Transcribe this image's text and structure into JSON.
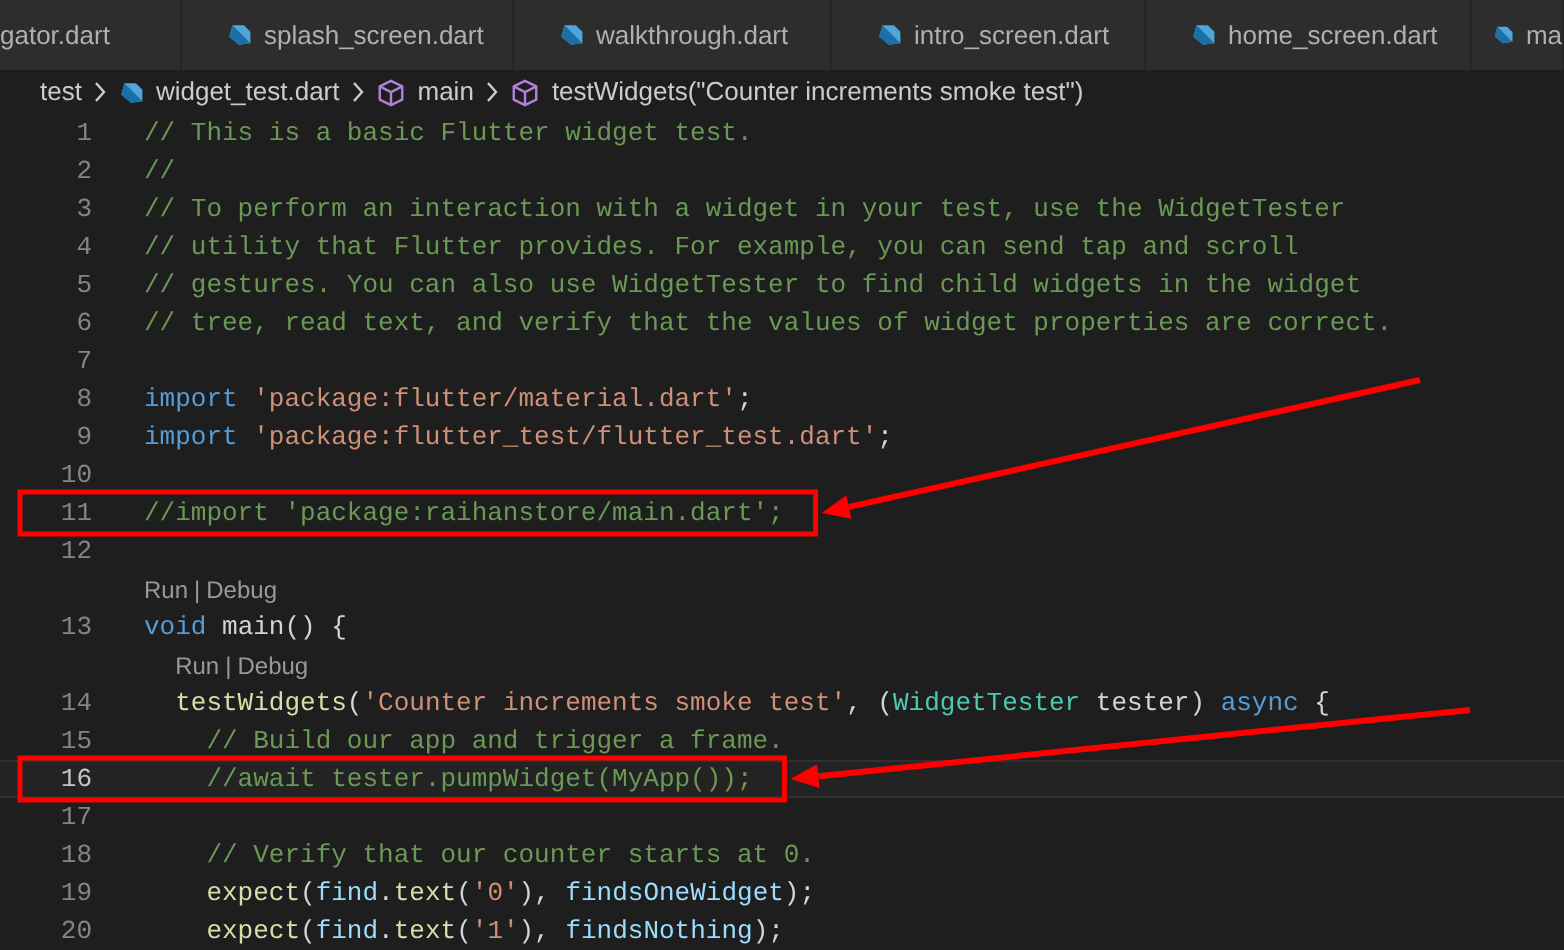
{
  "tabs": [
    {
      "label": "gator.dart",
      "icon": false,
      "selected": false
    },
    {
      "label": "splash_screen.dart",
      "icon": true,
      "selected": false
    },
    {
      "label": "walkthrough.dart",
      "icon": true,
      "selected": false
    },
    {
      "label": "intro_screen.dart",
      "icon": true,
      "selected": false
    },
    {
      "label": "home_screen.dart",
      "icon": true,
      "selected": false
    },
    {
      "label": "ma",
      "icon": true,
      "selected": false
    }
  ],
  "breadcrumb": [
    {
      "label": "test",
      "kind": "folder"
    },
    {
      "label": "widget_test.dart",
      "kind": "file"
    },
    {
      "label": "main",
      "kind": "symbol"
    },
    {
      "label": "testWidgets(\"Counter increments smoke test\")",
      "kind": "symbol"
    }
  ],
  "editor": {
    "rows": [
      {
        "kind": "code",
        "number": "1",
        "current": false,
        "annotated": false,
        "tokens": [
          {
            "kind": "comment",
            "text": "// This is a basic Flutter widget test."
          }
        ]
      },
      {
        "kind": "code",
        "number": "2",
        "current": false,
        "annotated": false,
        "tokens": [
          {
            "kind": "comment",
            "text": "//"
          }
        ]
      },
      {
        "kind": "code",
        "number": "3",
        "current": false,
        "annotated": false,
        "tokens": [
          {
            "kind": "comment",
            "text": "// To perform an interaction with a widget in your test, use the WidgetTester"
          }
        ]
      },
      {
        "kind": "code",
        "number": "4",
        "current": false,
        "annotated": false,
        "tokens": [
          {
            "kind": "comment",
            "text": "// utility that Flutter provides. For example, you can send tap and scroll"
          }
        ]
      },
      {
        "kind": "code",
        "number": "5",
        "current": false,
        "annotated": false,
        "tokens": [
          {
            "kind": "comment",
            "text": "// gestures. You can also use WidgetTester to find child widgets in the widget"
          }
        ]
      },
      {
        "kind": "code",
        "number": "6",
        "current": false,
        "annotated": false,
        "tokens": [
          {
            "kind": "comment",
            "text": "// tree, read text, and verify that the values of widget properties are correct."
          }
        ]
      },
      {
        "kind": "code",
        "number": "7",
        "current": false,
        "annotated": false,
        "tokens": []
      },
      {
        "kind": "code",
        "number": "8",
        "current": false,
        "annotated": false,
        "tokens": [
          {
            "kind": "keyword",
            "text": "import"
          },
          {
            "kind": "string",
            "text": " 'package:flutter/material.dart'"
          },
          {
            "kind": "plain",
            "text": ";"
          }
        ]
      },
      {
        "kind": "code",
        "number": "9",
        "current": false,
        "annotated": false,
        "tokens": [
          {
            "kind": "keyword",
            "text": "import"
          },
          {
            "kind": "string",
            "text": " 'package:flutter_test/flutter_test.dart'"
          },
          {
            "kind": "plain",
            "text": ";"
          }
        ]
      },
      {
        "kind": "code",
        "number": "10",
        "current": false,
        "annotated": false,
        "tokens": []
      },
      {
        "kind": "code",
        "number": "11",
        "current": false,
        "annotated": true,
        "tokens": [
          {
            "kind": "comment",
            "text": "//import 'package:raihanstore/main.dart';"
          }
        ]
      },
      {
        "kind": "code",
        "number": "12",
        "current": false,
        "annotated": false,
        "tokens": []
      },
      {
        "kind": "codelens",
        "links": [
          "Run",
          "Debug"
        ],
        "separator": "|"
      },
      {
        "kind": "code",
        "number": "13",
        "current": false,
        "annotated": false,
        "tokens": [
          {
            "kind": "keyword",
            "text": "void"
          },
          {
            "kind": "plain",
            "text": " main() {"
          }
        ]
      },
      {
        "kind": "codelens",
        "links": [
          "Run",
          "Debug"
        ],
        "separator": "|"
      },
      {
        "kind": "code",
        "number": "14",
        "current": false,
        "annotated": false,
        "tokens": [
          {
            "kind": "fn",
            "text": "  testWidgets"
          },
          {
            "kind": "plain",
            "text": "("
          },
          {
            "kind": "string",
            "text": "'Counter increments smoke test'"
          },
          {
            "kind": "plain",
            "text": ", ("
          },
          {
            "kind": "type",
            "text": "WidgetTester"
          },
          {
            "kind": "plain",
            "text": " tester) "
          },
          {
            "kind": "keyword",
            "text": "async"
          },
          {
            "kind": "plain",
            "text": " {"
          }
        ]
      },
      {
        "kind": "code",
        "number": "15",
        "current": false,
        "annotated": false,
        "tokens": [
          {
            "kind": "comment",
            "text": "    // Build our app and trigger a frame."
          }
        ]
      },
      {
        "kind": "code",
        "number": "16",
        "current": true,
        "annotated": true,
        "tokens": [
          {
            "kind": "comment",
            "text": "    //await tester.pumpWidget(MyApp());"
          }
        ]
      },
      {
        "kind": "code",
        "number": "17",
        "current": false,
        "annotated": false,
        "tokens": []
      },
      {
        "kind": "code",
        "number": "18",
        "current": false,
        "annotated": false,
        "tokens": [
          {
            "kind": "comment",
            "text": "    // Verify that our counter starts at 0."
          }
        ]
      },
      {
        "kind": "code",
        "number": "19",
        "current": false,
        "annotated": false,
        "tokens": [
          {
            "kind": "fn",
            "text": "    expect"
          },
          {
            "kind": "plain",
            "text": "("
          },
          {
            "kind": "var",
            "text": "find"
          },
          {
            "kind": "plain",
            "text": "."
          },
          {
            "kind": "fn",
            "text": "text"
          },
          {
            "kind": "plain",
            "text": "("
          },
          {
            "kind": "string",
            "text": "'0'"
          },
          {
            "kind": "plain",
            "text": "), "
          },
          {
            "kind": "var",
            "text": "findsOneWidget"
          },
          {
            "kind": "plain",
            "text": ");"
          }
        ]
      },
      {
        "kind": "code",
        "number": "20",
        "current": false,
        "annotated": false,
        "tokens": [
          {
            "kind": "fn",
            "text": "    expect"
          },
          {
            "kind": "plain",
            "text": "("
          },
          {
            "kind": "var",
            "text": "find"
          },
          {
            "kind": "plain",
            "text": "."
          },
          {
            "kind": "fn",
            "text": "text"
          },
          {
            "kind": "plain",
            "text": "("
          },
          {
            "kind": "string",
            "text": "'1'"
          },
          {
            "kind": "plain",
            "text": "), "
          },
          {
            "kind": "var",
            "text": "findsNothing"
          },
          {
            "kind": "plain",
            "text": ");"
          }
        ]
      }
    ]
  }
}
